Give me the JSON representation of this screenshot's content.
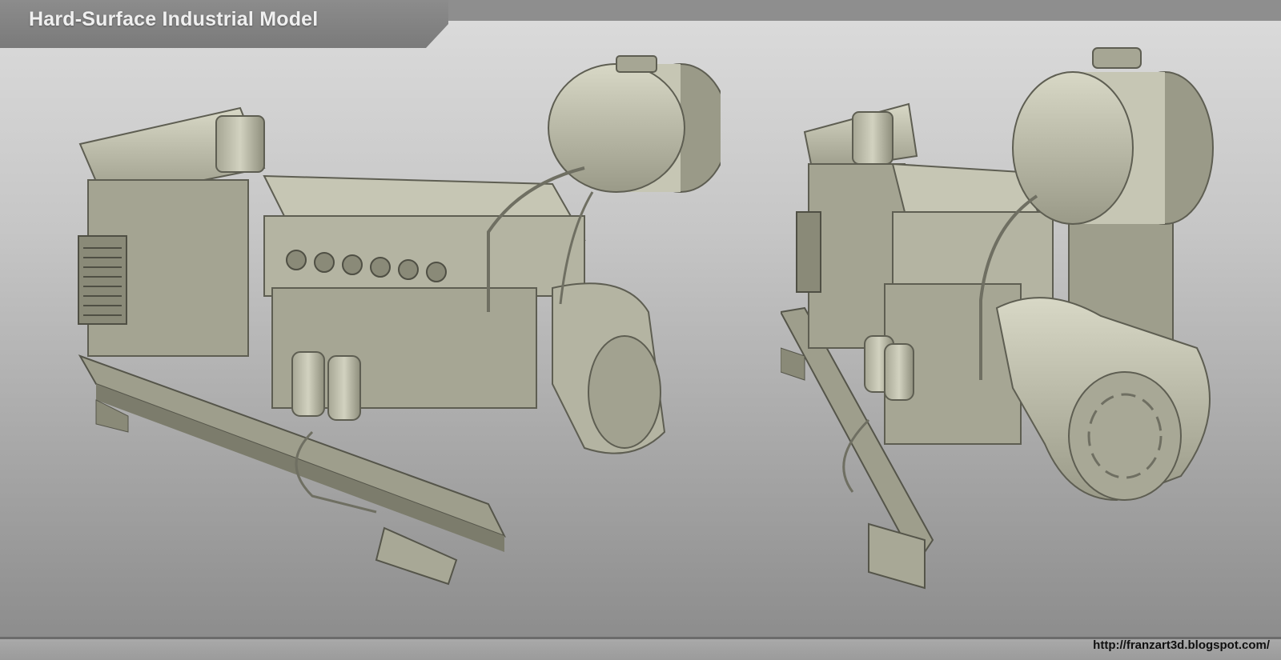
{
  "header": {
    "title": "Hard-Surface Industrial Model"
  },
  "footer": {
    "url": "http://franzart3d.blogspot.com/"
  },
  "colors": {
    "model_base": "#b9b9a6",
    "model_shadow": "#6f6f62",
    "model_highlight": "#deded0"
  }
}
